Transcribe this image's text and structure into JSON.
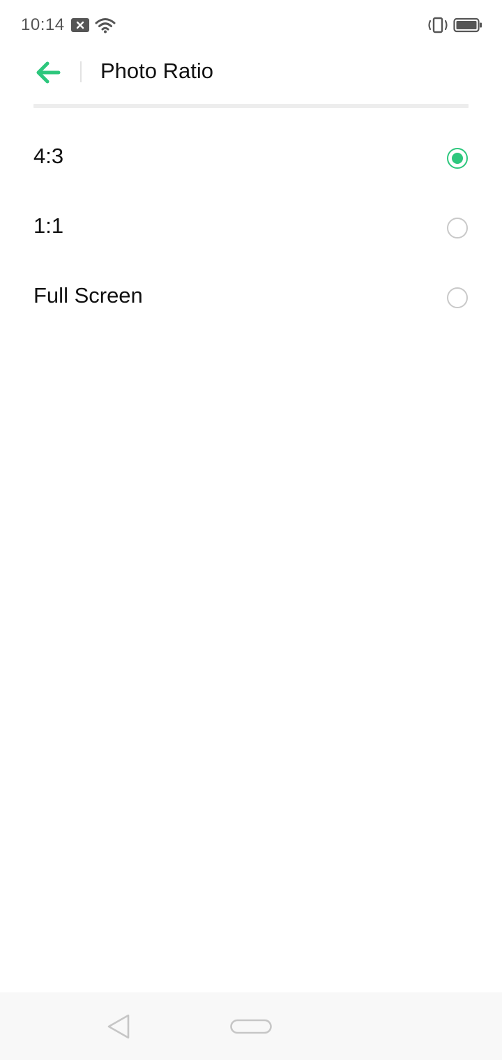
{
  "status_bar": {
    "time": "10:14",
    "icons": [
      "notification-icon",
      "wifi-icon",
      "vibrate-icon",
      "battery-icon"
    ]
  },
  "toolbar": {
    "back_icon": "arrow-left-icon",
    "title": "Photo Ratio"
  },
  "colors": {
    "accent": "#2dc77d",
    "text": "#111111",
    "radio_unchecked": "#c9c9c9",
    "nav_background": "#f8f8f8"
  },
  "photo_ratio": {
    "options": [
      {
        "label": "4:3",
        "selected": true
      },
      {
        "label": "1:1",
        "selected": false
      },
      {
        "label": "Full Screen",
        "selected": false
      }
    ]
  },
  "nav_bar": {
    "icons": [
      "nav-back-icon",
      "nav-home-icon"
    ]
  }
}
